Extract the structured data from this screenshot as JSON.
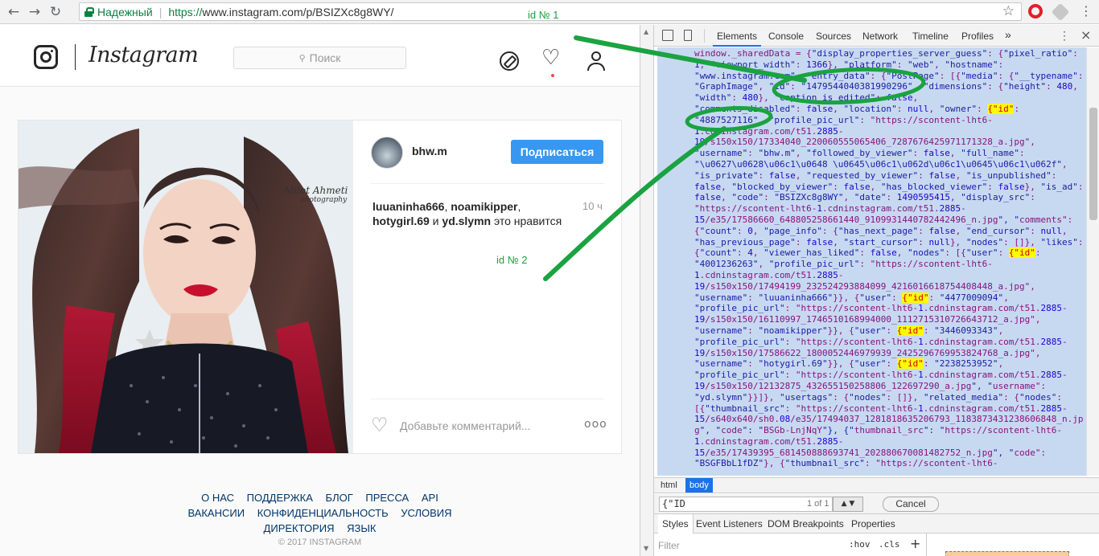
{
  "browser": {
    "secure_label": "Надежный",
    "url_scheme": "https://",
    "url_rest": "www.instagram.com/p/BSIZXc8g8WY/",
    "icons": [
      "back-icon",
      "forward-icon",
      "reload-icon",
      "lock-icon",
      "star-icon",
      "opera-icon",
      "extension-icon",
      "menu-icon"
    ]
  },
  "instagram": {
    "wordmark": "Instagram",
    "search_placeholder": "Поиск",
    "post": {
      "username": "bhw.m",
      "follow_label": "Подписаться",
      "likes_users": [
        "luuaninha666",
        "noamikipper",
        "hotygirl.69",
        "yd.slymn"
      ],
      "likes_sep": ", ",
      "likes_and": " и ",
      "likes_suffix": " это нравится",
      "time_ago": "10 ч",
      "comment_placeholder": "Добавьте комментарий...",
      "more_label": "ooo",
      "watermark_line1": "Milot Ahmeti",
      "watermark_line2": "photography"
    },
    "footer": {
      "row1": [
        "О НАС",
        "ПОДДЕРЖКА",
        "БЛОГ",
        "ПРЕССА",
        "API"
      ],
      "row2": [
        "ВАКАНСИИ",
        "КОНФИДЕНЦИАЛЬНОСТЬ",
        "УСЛОВИЯ"
      ],
      "row3": [
        "ДИРЕКТОРИЯ",
        "ЯЗЫК"
      ],
      "copyright": "© 2017 INSTAGRAM"
    }
  },
  "annotations": {
    "id1": "id № 1",
    "id2": "id № 2",
    "color": "#1aa340"
  },
  "devtools": {
    "tabs": [
      "Elements",
      "Console",
      "Sources",
      "Network",
      "Timeline",
      "Profiles"
    ],
    "more_tabs": "»",
    "active_tab": "Elements",
    "code_lines": [
      "window._sharedData = {\"display_properties_server_guess\": {\"pixel_ratio\":",
      "1, \"viewport_width\": 1366}, \"platform\": \"web\", \"hostname\":",
      "\"www.instagram.com\", \"entry_data\": {\"PostPage\": [{\"media\": {\"__typename\":",
      "\"GraphImage\", \"id\": \"1479544040381990296\", \"dimensions\": {\"height\": 480,",
      "\"width\": 480}, \"caption_is_edited\": false,",
      "\"comments_disabled\": false, \"location\": null, \"owner\": {\"id\":",
      "\"4887527116\", \"profile_pic_url\": \"https://scontent-lht6-",
      "1.cdninstagram.com/t51.2885-",
      "19/s150x150/17334040_220060555065406_7287676425971171328_a.jpg\",",
      "\"username\": \"bhw.m\", \"followed_by_viewer\": false, \"full_name\":",
      "\"\\u0627\\u0628\\u06c1\\u0648 \\u0645\\u06c1\\u062d\\u06c1\\u0645\\u06c1\\u062f\",",
      "\"is_private\": false, \"requested_by_viewer\": false, \"is_unpublished\":",
      "false, \"blocked_by_viewer\": false, \"has_blocked_viewer\": false}, \"is_ad\":",
      "false, \"code\": \"BSIZXc8g8WY\", \"date\": 1490595415, \"display_src\":",
      "\"https://scontent-lht6-1.cdninstagram.com/t51.2885-",
      "15/e35/17586660_648805258661440_9109931440782442496_n.jpg\", \"comments\":",
      "{\"count\": 0, \"page_info\": {\"has_next_page\": false, \"end_cursor\": null,",
      "\"has_previous_page\": false, \"start_cursor\": null}, \"nodes\": []}, \"likes\":",
      "{\"count\": 4, \"viewer_has_liked\": false, \"nodes\": [{\"user\": {\"id\":",
      "\"4001236263\", \"profile_pic_url\": \"https://scontent-lht6-",
      "1.cdninstagram.com/t51.2885-",
      "19/s150x150/17494199_232524293884099_421601661875440844​8_a.jpg\",",
      "\"username\": \"luuaninha666\"}}, {\"user\": {\"id\": \"4477009094\",",
      "\"profile_pic_url\": \"https://scontent-lht6-1.cdninstagram.com/t51.2885-",
      "19/s150x150/16110997_1746510168994000_1112715310726643712_a.jpg\",",
      "\"username\": \"noamikipper\"}}, {\"user\": {\"id\": \"3446093343\",",
      "\"profile_pic_url\": \"https://scontent-lht6-1.cdninstagram.com/t51.2885-",
      "19/s150x150/17586622_1800052446979939_2425296769953824768_a.jpg\",",
      "\"username\": \"hotygirl.69\"}}, {\"user\": {\"id\": \"2238253952\",",
      "\"profile_pic_url\": \"https://scontent-lht6-1.cdninstagram.com/t51.2885-",
      "19/s150x150/12132875_432655150258806_122697290_a.jpg\", \"username\":",
      "\"yd.slymn\"}}]}, \"usertags\": {\"nodes\": []}, \"related_media\": {\"nodes\":",
      "[{\"thumbnail_src\": \"https://scontent-lht6-1.cdninstagram.com/t51.2885-",
      "15/s640x640/sh0.08/e35/17494037_1281818635206793_1183873431238606848_n.jp",
      "g\", \"code\": \"BSGb-LnjNqY\"}, {\"thumbnail_src\": \"https://scontent-lht6-",
      "1.cdninstagram.com/t51.2885-",
      "15/e35/17439395_681450888693741_2028806700814827​52_n.jpg\", \"code\":",
      "\"BSGFBbL1fDZ\"}, {\"thumbnail_src\": \"https://scontent-lht6-"
    ],
    "breadcrumbs": [
      "html",
      "body"
    ],
    "find_value": "{\"ID",
    "find_count": "1 of 1",
    "find_cancel": "Cancel",
    "find_nav": "▲ ▼",
    "subtabs": [
      "Styles",
      "Event Listeners",
      "DOM Breakpoints",
      "Properties"
    ],
    "filter_placeholder": "Filter",
    "filter_hov": ":hov",
    "filter_cls": ".cls",
    "filter_plus": "+"
  }
}
